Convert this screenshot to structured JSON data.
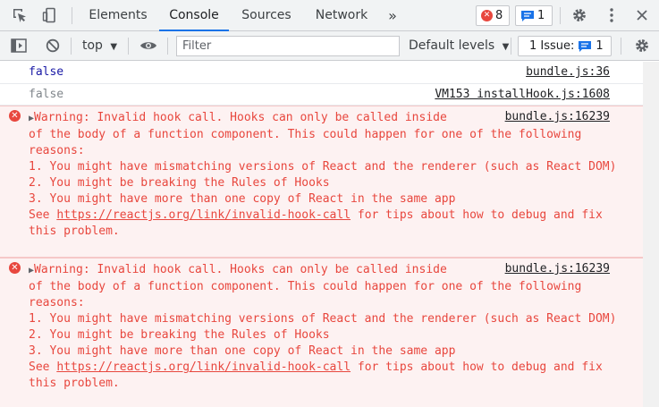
{
  "tabs": [
    {
      "label": "Elements"
    },
    {
      "label": "Console"
    },
    {
      "label": "Sources"
    },
    {
      "label": "Network"
    }
  ],
  "more_tabs_glyph": "»",
  "error_badge": {
    "count": "8"
  },
  "message_badge": {
    "count": "1"
  },
  "toolbar": {
    "context": "top",
    "filter_placeholder": "Filter",
    "levels": "Default levels",
    "issues_label": "1 Issue:",
    "issues_count": "1"
  },
  "log": [
    {
      "value": "false",
      "source": "bundle.js:36",
      "color": "#1a1aa6"
    },
    {
      "value": "false",
      "source": "VM153 installHook.js:1608",
      "color": "#80868b"
    }
  ],
  "errors": [
    {
      "line1": "Warning: Invalid hook call. Hooks can only be called inside",
      "rest": "of the body of a function component. This could happen for one of the following reasons:\n1. You might have mismatching versions of React and the renderer (such as React DOM)\n2. You might be breaking the Rules of Hooks\n3. You might have more than one copy of React in the same app",
      "see": "See",
      "link": "https://reactjs.org/link/invalid-hook-call",
      "tail": "for tips about how to debug and fix this problem.",
      "source": "bundle.js:16239"
    },
    {
      "line1": "Warning: Invalid hook call. Hooks can only be called inside",
      "rest": "of the body of a function component. This could happen for one of the following reasons:\n1. You might have mismatching versions of React and the renderer (such as React DOM)\n2. You might be breaking the Rules of Hooks\n3. You might have more than one copy of React in the same app",
      "see": "See",
      "link": "https://reactjs.org/link/invalid-hook-call",
      "tail": "for tips about how to debug and fix this problem.",
      "source": "bundle.js:16239"
    }
  ]
}
